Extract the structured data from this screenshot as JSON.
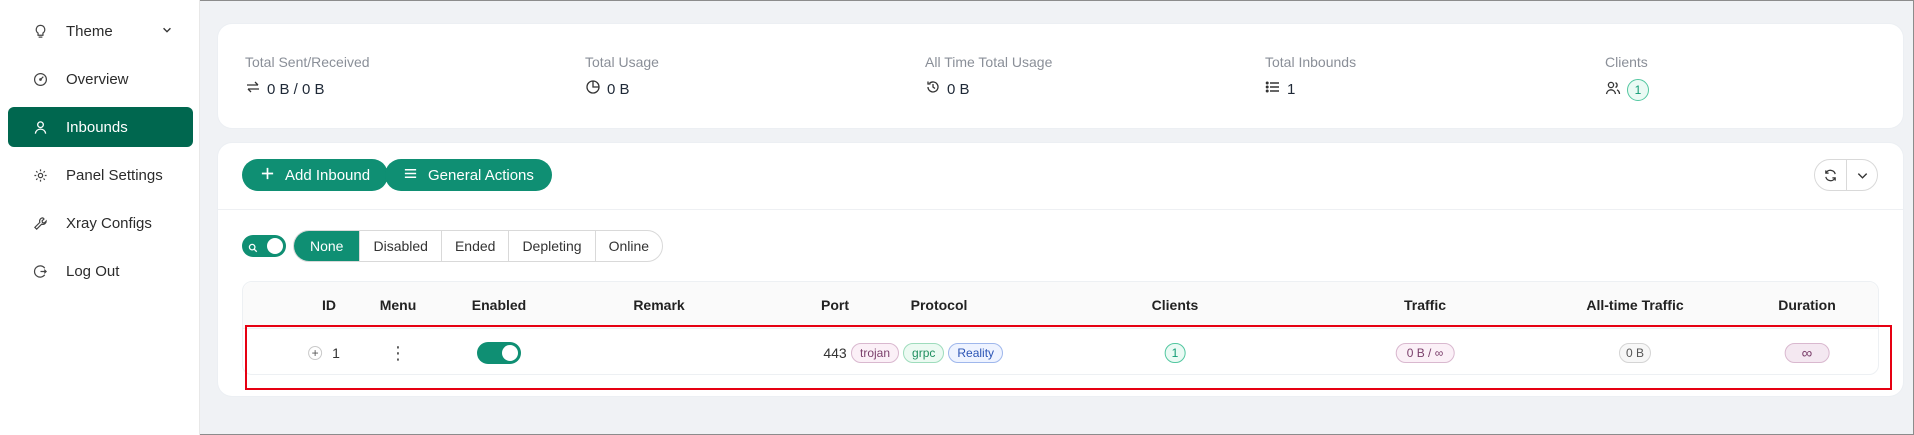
{
  "sidebar": {
    "items": [
      {
        "label": "Theme",
        "icon": "bulb-icon",
        "active": false,
        "has_caret": true
      },
      {
        "label": "Overview",
        "icon": "dashboard-icon",
        "active": false
      },
      {
        "label": "Inbounds",
        "icon": "user-icon",
        "active": true
      },
      {
        "label": "Panel Settings",
        "icon": "gear-icon",
        "active": false
      },
      {
        "label": "Xray Configs",
        "icon": "tool-icon",
        "active": false
      },
      {
        "label": "Log Out",
        "icon": "logout-icon",
        "active": false
      }
    ]
  },
  "stats": {
    "total_sent_received": {
      "label": "Total Sent/Received",
      "value": "0 B / 0 B"
    },
    "total_usage": {
      "label": "Total Usage",
      "value": "0 B"
    },
    "all_time_total_usage": {
      "label": "All Time Total Usage",
      "value": "0 B"
    },
    "total_inbounds": {
      "label": "Total Inbounds",
      "value": "1"
    },
    "clients": {
      "label": "Clients",
      "value": "1"
    }
  },
  "toolbar": {
    "add_inbound_label": "Add Inbound",
    "general_actions_label": "General Actions"
  },
  "filters": {
    "options": [
      "None",
      "Disabled",
      "Ended",
      "Depleting",
      "Online"
    ],
    "selected": "None"
  },
  "table": {
    "columns": [
      "ID",
      "Menu",
      "Enabled",
      "Remark",
      "Port",
      "Protocol",
      "Clients",
      "Traffic",
      "All-time Traffic",
      "Duration"
    ],
    "rows": [
      {
        "id": "1",
        "enabled": true,
        "remark": "",
        "port": "443",
        "protocol_tags": [
          "trojan",
          "grpc",
          "Reality"
        ],
        "clients": "1",
        "traffic": "0 B / ∞",
        "all_time_traffic": "0 B",
        "duration": "∞"
      }
    ]
  },
  "colors": {
    "accent": "#0f8f73",
    "sidebar_active": "#00674f",
    "highlight_border": "#e60012"
  }
}
